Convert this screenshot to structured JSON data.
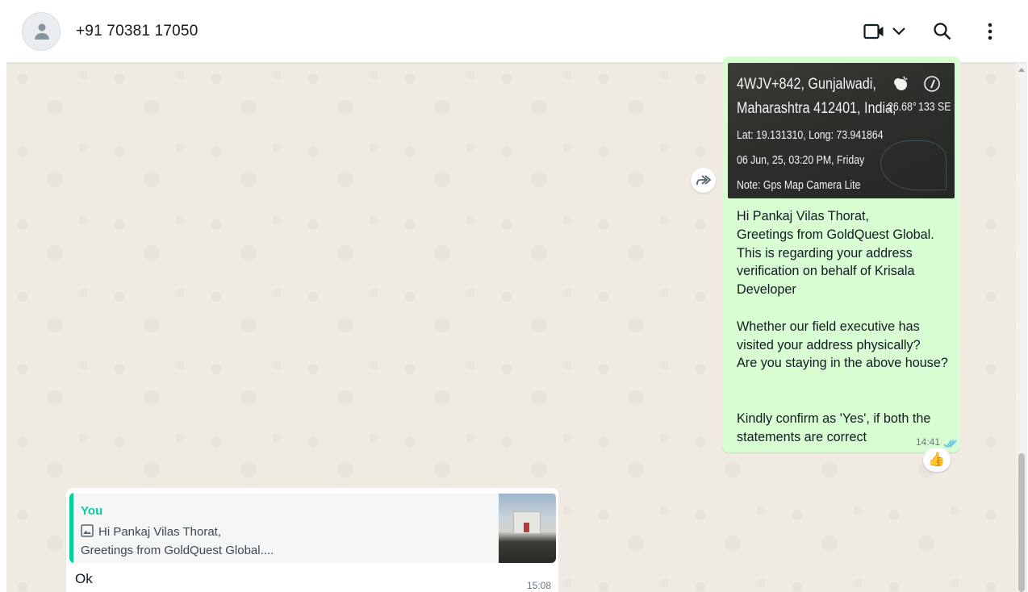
{
  "header": {
    "contact_name": "+91 70381 17050",
    "icons": [
      "video-call-icon",
      "chevron-down-icon",
      "search-icon",
      "menu-icon"
    ]
  },
  "outgoing_message": {
    "location_image": {
      "address_line1": "4WJV+842, Gunjalwadi,",
      "address_line2": "Maharashtra 412401, India,",
      "temperature": "26.68°",
      "compass": "133 SE",
      "coordinates": "Lat: 19.131310, Long: 73.941864",
      "datetime": "06 Jun, 25, 03:20 PM, Friday",
      "note": "Note: Gps Map Camera Lite"
    },
    "text": "Hi Pankaj Vilas Thorat,\nGreetings from GoldQuest Global.\nThis is regarding your address verification on behalf of Krisala Developer\n\nWhether our field executive has visited your address physically?\nAre you staying in the above house?\n\n\nKindly confirm as 'Yes', if both the statements are correct",
    "time": "14:41",
    "status": "read",
    "reaction": "👍"
  },
  "incoming_message": {
    "quote_author": "You",
    "quote_line1": "Hi Pankaj Vilas Thorat,",
    "quote_line2": "Greetings from GoldQuest Global....",
    "text": "Ok",
    "time": "15:08"
  },
  "colors": {
    "outgoing_bubble": "#d9fdd3",
    "incoming_bubble": "#ffffff",
    "chat_background": "#efeae2",
    "quote_accent": "#06cf9c",
    "read_ticks": "#53bdeb"
  }
}
